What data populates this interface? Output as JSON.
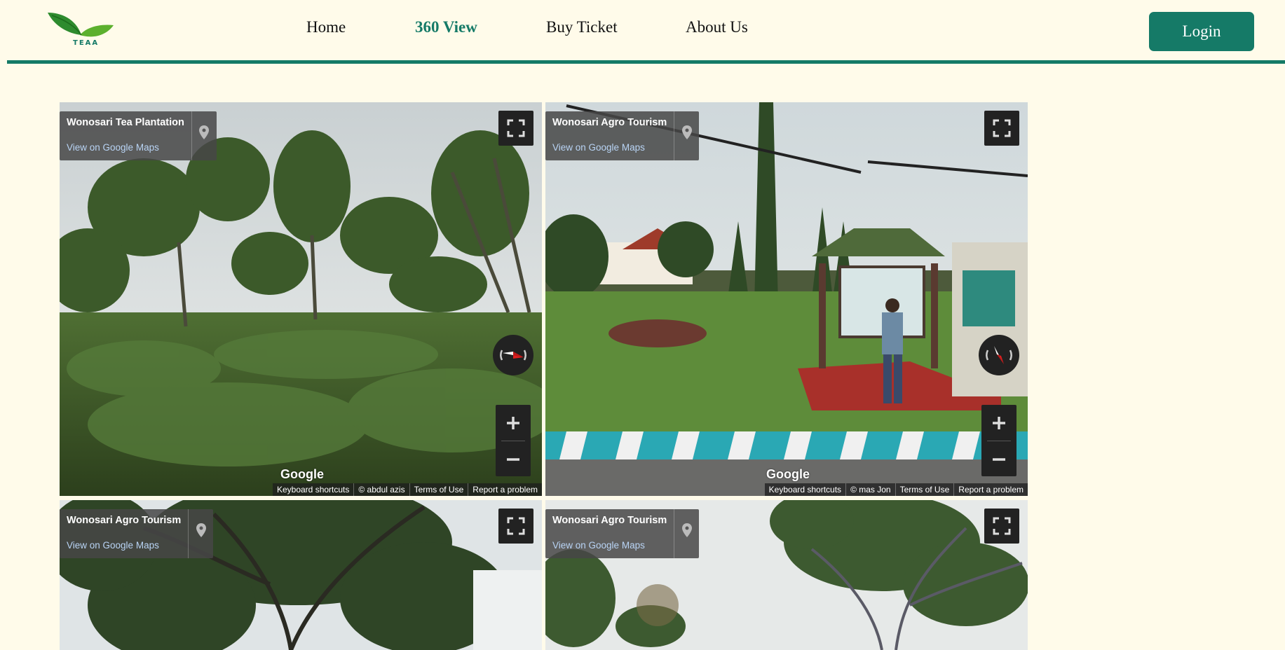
{
  "brand": {
    "logo_text": "TEAA",
    "accent_color": "#157a67",
    "background_color": "#fffbea"
  },
  "nav": {
    "items": [
      {
        "label": "Home",
        "active": false
      },
      {
        "label": "360 View",
        "active": true
      },
      {
        "label": "Buy Ticket",
        "active": false
      },
      {
        "label": "About Us",
        "active": false
      }
    ],
    "login_label": "Login"
  },
  "panoramas": [
    {
      "title": "Wonosari Tea Plantation",
      "link": "View on Google Maps",
      "google": "Google",
      "footer": [
        "Keyboard shortcuts",
        "© abdul azis",
        "Terms of Use",
        "Report a problem"
      ]
    },
    {
      "title": "Wonosari Agro Tourism",
      "link": "View on Google Maps",
      "google": "Google",
      "footer": [
        "Keyboard shortcuts",
        "© mas Jon",
        "Terms of Use",
        "Report a problem"
      ]
    },
    {
      "title": "Wonosari Agro Tourism",
      "link": "View on Google Maps"
    },
    {
      "title": "Wonosari Agro Tourism",
      "link": "View on Google Maps"
    }
  ],
  "icons": {
    "logo": "leaf-logo-icon",
    "pin": "map-pin-icon",
    "fullscreen": "fullscreen-icon",
    "compass": "compass-icon",
    "zoom_in": "plus-icon",
    "zoom_out": "minus-icon"
  }
}
